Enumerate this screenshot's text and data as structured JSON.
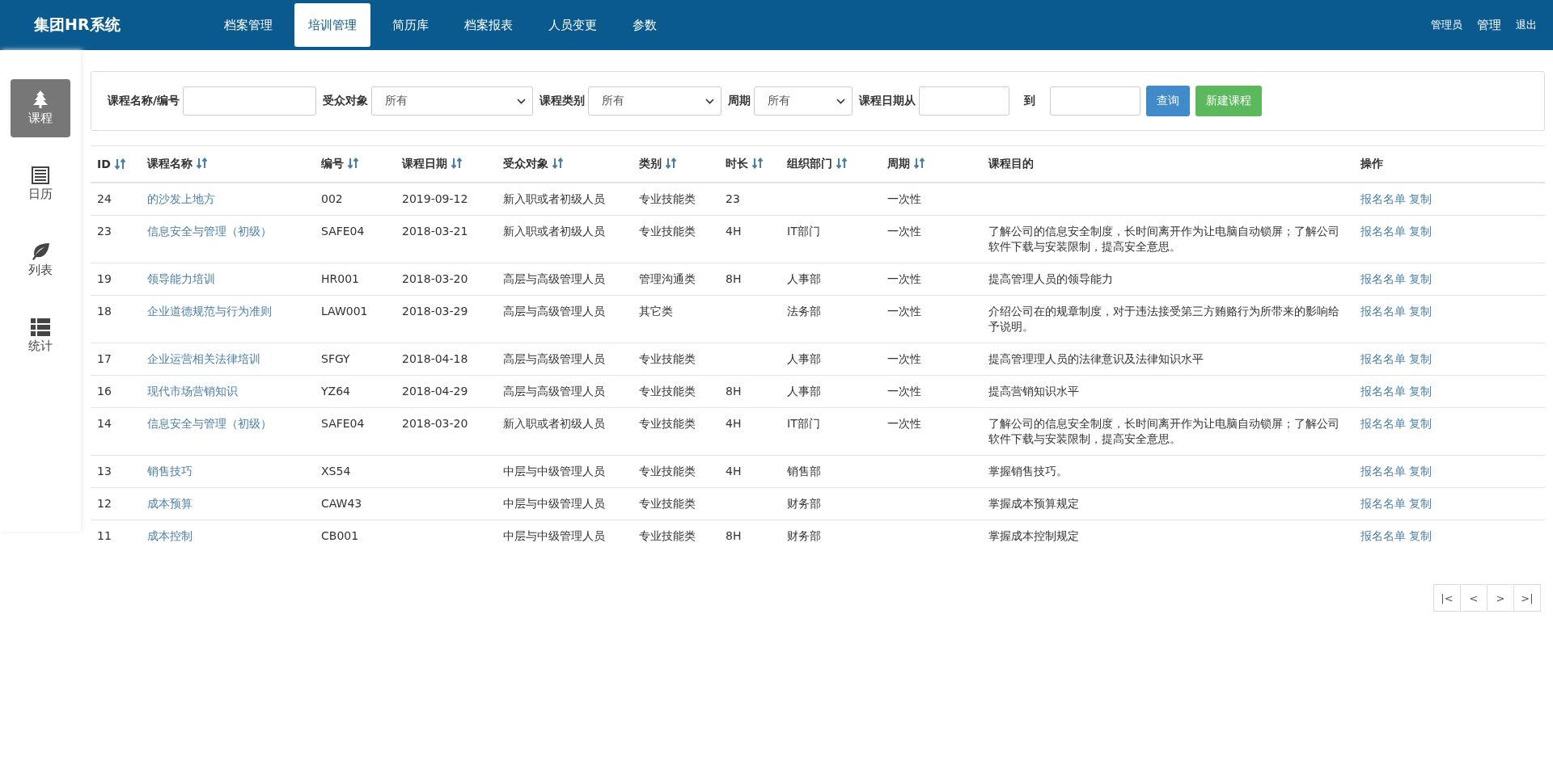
{
  "app": {
    "title": "集团HR系统"
  },
  "nav": [
    {
      "label": "档案管理",
      "selected": false
    },
    {
      "label": "培训管理",
      "selected": true
    },
    {
      "label": "简历库",
      "selected": false
    },
    {
      "label": "档案报表",
      "selected": false
    },
    {
      "label": "人员变更",
      "selected": false
    },
    {
      "label": "参数",
      "selected": false
    }
  ],
  "user_links": [
    "管理员",
    "管理",
    "退出"
  ],
  "sidebar": [
    {
      "label": "课程",
      "selected": true
    },
    {
      "label": "日历",
      "selected": false
    },
    {
      "label": "列表",
      "selected": false
    },
    {
      "label": "统计",
      "selected": false
    }
  ],
  "filters": [
    {
      "kind": "text",
      "label": "课程名称/编号"
    },
    {
      "kind": "select",
      "label": "受众对象",
      "value": "所有"
    },
    {
      "kind": "select",
      "label": "课程类别",
      "value": "所有"
    },
    {
      "kind": "select",
      "label": "周期",
      "value": "所有"
    },
    {
      "kind": "text",
      "label": "课程日期从"
    },
    {
      "kind": "text",
      "label": "到"
    }
  ],
  "buttons": [
    {
      "kind": "primary",
      "label": "查询"
    },
    {
      "kind": "success",
      "label": "新建课程"
    }
  ],
  "table": {
    "columns": [
      {
        "label": "ID",
        "sortable": true
      },
      {
        "label": "课程名称",
        "sortable": true
      },
      {
        "label": "编号",
        "sortable": true
      },
      {
        "label": "课程日期",
        "sortable": true
      },
      {
        "label": "受众对象",
        "sortable": true
      },
      {
        "label": "类别",
        "sortable": true
      },
      {
        "label": "时长",
        "sortable": true
      },
      {
        "label": "组织部门",
        "sortable": true
      },
      {
        "label": "周期",
        "sortable": true
      },
      {
        "label": "课程目的",
        "sortable": false
      },
      {
        "label": "操作",
        "sortable": false
      }
    ],
    "rows": [
      {
        "id": "24",
        "name": "的沙发上地方",
        "code": "002",
        "date": "2019-09-12",
        "audience": "新入职或者初级人员",
        "category": "专业技能类",
        "duration": "23",
        "cycle": "一次性",
        "actions": [
          "报名名单",
          "复制"
        ]
      },
      {
        "id": "23",
        "name": "信息安全与管理（初级）",
        "code": "SAFE04",
        "date": "2018-03-21",
        "audience": "新入职或者初级人员",
        "category": "专业技能类",
        "duration": "4H",
        "department": "IT部门",
        "cycle": "一次性",
        "purpose": "了解公司的信息安全制度，长时间离开作为让电脑自动锁屏；了解公司软件下载与安装限制，提高安全意思。",
        "actions": [
          "报名名单",
          "复制"
        ]
      },
      {
        "id": "19",
        "name": "领导能力培训",
        "code": "HR001",
        "date": "2018-03-20",
        "audience": "高层与高级管理人员",
        "category": "管理沟通类",
        "duration": "8H",
        "department": "人事部",
        "cycle": "一次性",
        "purpose": "提高管理人员的领导能力",
        "actions": [
          "报名名单",
          "复制"
        ]
      },
      {
        "id": "18",
        "name": "企业道德规范与行为准则",
        "code": "LAW001",
        "date": "2018-03-29",
        "audience": "高层与高级管理人员",
        "category": "其它类",
        "department": "法务部",
        "cycle": "一次性",
        "purpose": "介绍公司在的规章制度，对于违法接受第三方贿赂行为所带来的影响给予说明。",
        "actions": [
          "报名名单",
          "复制"
        ]
      },
      {
        "id": "17",
        "name": "企业运营相关法律培训",
        "code": "SFGY",
        "date": "2018-04-18",
        "audience": "高层与高级管理人员",
        "category": "专业技能类",
        "department": "人事部",
        "cycle": "一次性",
        "purpose": "提高管理理人员的法律意识及法律知识水平",
        "actions": [
          "报名名单",
          "复制"
        ]
      },
      {
        "id": "16",
        "name": "现代市场营销知识",
        "code": "YZ64",
        "date": "2018-04-29",
        "audience": "高层与高级管理人员",
        "category": "专业技能类",
        "duration": "8H",
        "department": "人事部",
        "cycle": "一次性",
        "purpose": "提高营销知识水平",
        "actions": [
          "报名名单",
          "复制"
        ]
      },
      {
        "id": "14",
        "name": "信息安全与管理（初级）",
        "code": "SAFE04",
        "date": "2018-03-20",
        "audience": "新入职或者初级人员",
        "category": "专业技能类",
        "duration": "4H",
        "department": "IT部门",
        "cycle": "一次性",
        "purpose": "了解公司的信息安全制度，长时间离开作为让电脑自动锁屏；了解公司软件下载与安装限制，提高安全意思。",
        "actions": [
          "报名名单",
          "复制"
        ]
      },
      {
        "id": "13",
        "name": "销售技巧",
        "code": "XS54",
        "audience": "中层与中级管理人员",
        "category": "专业技能类",
        "duration": "4H",
        "department": "销售部",
        "purpose": "掌握销售技巧。",
        "actions": [
          "报名名单",
          "复制"
        ]
      },
      {
        "id": "12",
        "name": "成本预算",
        "code": "CAW43",
        "audience": "中层与中级管理人员",
        "category": "专业技能类",
        "department": "财务部",
        "purpose": "掌握成本预算规定",
        "actions": [
          "报名名单",
          "复制"
        ]
      },
      {
        "id": "11",
        "name": "成本控制",
        "code": "CB001",
        "audience": "中层与中级管理人员",
        "category": "专业技能类",
        "duration": "8H",
        "department": "财务部",
        "purpose": "掌握成本控制规定",
        "actions": [
          "报名名单",
          "复制"
        ]
      }
    ]
  },
  "pagination": [
    "|<",
    "<",
    ">",
    ">|"
  ]
}
